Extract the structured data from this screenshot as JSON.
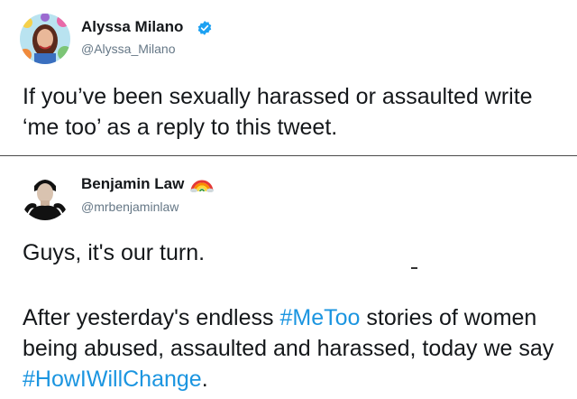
{
  "tweets": [
    {
      "display_name": "Alyssa Milano",
      "handle": "@Alyssa_Milano",
      "verified": true,
      "badge_icon": "verified-badge-icon",
      "text": "If you’ve been sexually harassed or assaulted write ‘me too’ as a reply to this tweet."
    },
    {
      "display_name": "Benjamin Law",
      "handle": "@mrbenjaminlaw",
      "name_emoji": "rainbow-icon",
      "text_line1": "Guys, it's our turn.",
      "text_part1": "After yesterday's endless ",
      "hashtag1": "#MeToo",
      "text_part2": " stories of women being abused, assaulted and harassed, today we say ",
      "hashtag2": "#HowIWillChange",
      "text_part3": "."
    }
  ],
  "colors": {
    "hashtag": "#1b95e0",
    "verified": "#1da1f2",
    "handle": "#657786",
    "text": "#14171a"
  }
}
